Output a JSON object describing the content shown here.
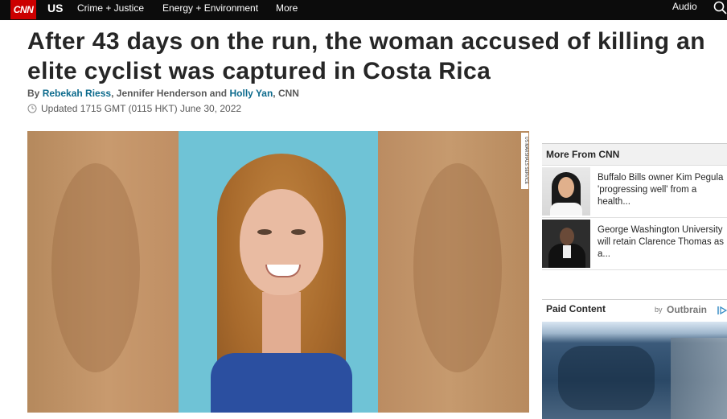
{
  "header": {
    "logo_text": "CNN",
    "section": "US",
    "nav_items": [
      "Crime + Justice",
      "Energy + Environment",
      "More"
    ],
    "audio_label": "Audio",
    "search_icon": "search-icon"
  },
  "article": {
    "headline": "After 43 days on the run, the woman accused of killing an elite cyclist was captured in Costa Rica",
    "byline": {
      "prefix": "By",
      "author1": "Rebekah Riess",
      "sep1": ",",
      "author2_plain": "Jennifer Henderson and",
      "author3": "Holly Yan",
      "suffix": ", CNN"
    },
    "updated": "Updated 1715 GMT (0115 HKT) June 30, 2022",
    "image_credit": "US MARSHALS SERVICE"
  },
  "more_from_cnn": {
    "title": "More From CNN",
    "stories": [
      {
        "text": "Buffalo Bills owner Kim Pegula 'progressing well' from a health..."
      },
      {
        "text": "George Washington University will retain Clarence Thomas as a..."
      }
    ]
  },
  "paid_content": {
    "title": "Paid Content",
    "by": "by",
    "provider": "Outbrain"
  },
  "colors": {
    "topbar": "#0c0c0c",
    "brand_red": "#cc0000",
    "link": "#0c6a8c"
  }
}
